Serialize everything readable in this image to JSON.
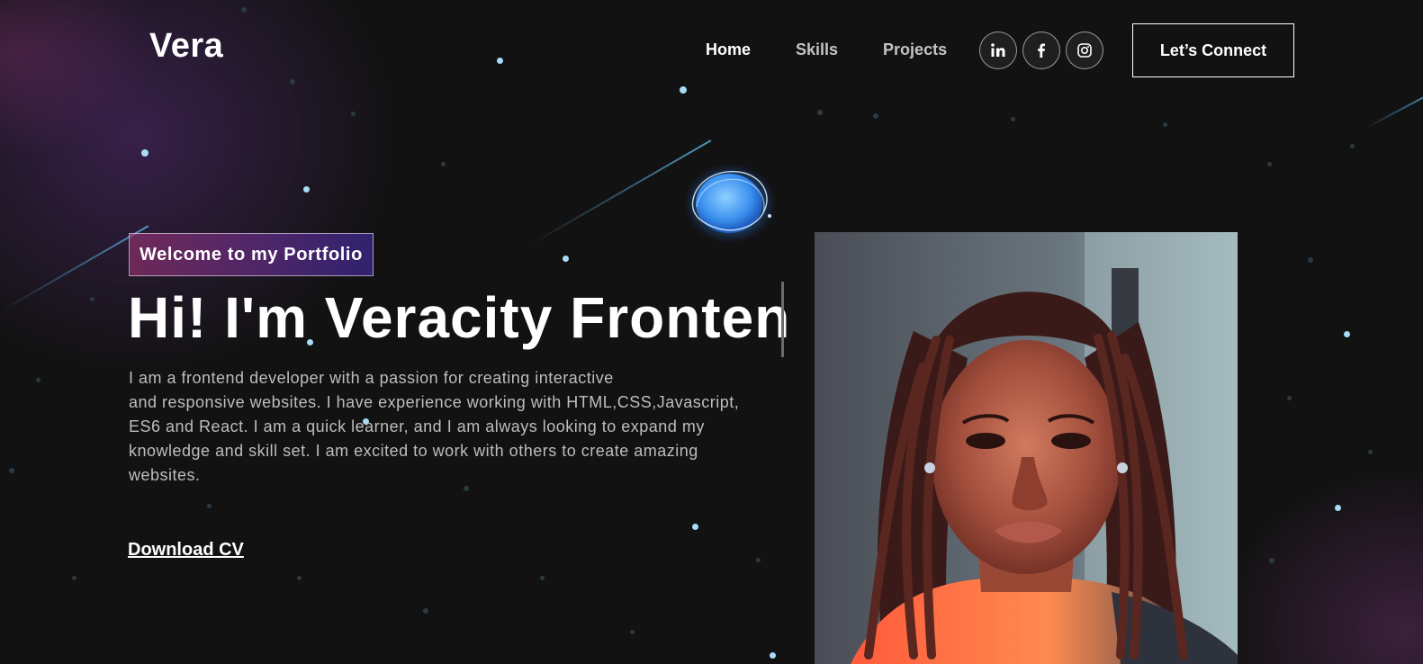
{
  "nav": {
    "logo": "Vera",
    "links": [
      {
        "label": "Home",
        "active": true
      },
      {
        "label": "Skills",
        "active": false
      },
      {
        "label": "Projects",
        "active": false
      }
    ],
    "social": [
      {
        "icon": "linkedin-icon",
        "label": "in"
      },
      {
        "icon": "facebook-icon",
        "label": "f"
      },
      {
        "icon": "instagram-icon"
      }
    ],
    "cta_label": "Let’s Connect"
  },
  "hero": {
    "tagline": "Welcome to my Portfolio",
    "title": "Hi! I'm Veracity Fronten",
    "description_lines": [
      "I am a frontend developer with a passion for creating interactive",
      "and responsive websites. I have experience working with HTML,CSS,Javascript,",
      "ES6 and React. I am a quick learner, and  I am always looking to expand my",
      "knowledge and skill set. I am excited to work with others to create amazing",
      "websites."
    ],
    "download_label": "Download CV",
    "orb_icon": "planet-orb-icon",
    "photo_icon": "profile-photo"
  },
  "colors": {
    "background": "#121212",
    "tagline_gradient_start": "#aa367c",
    "tagline_gradient_end": "#4a2fbd",
    "star": "#a8dcf5"
  }
}
